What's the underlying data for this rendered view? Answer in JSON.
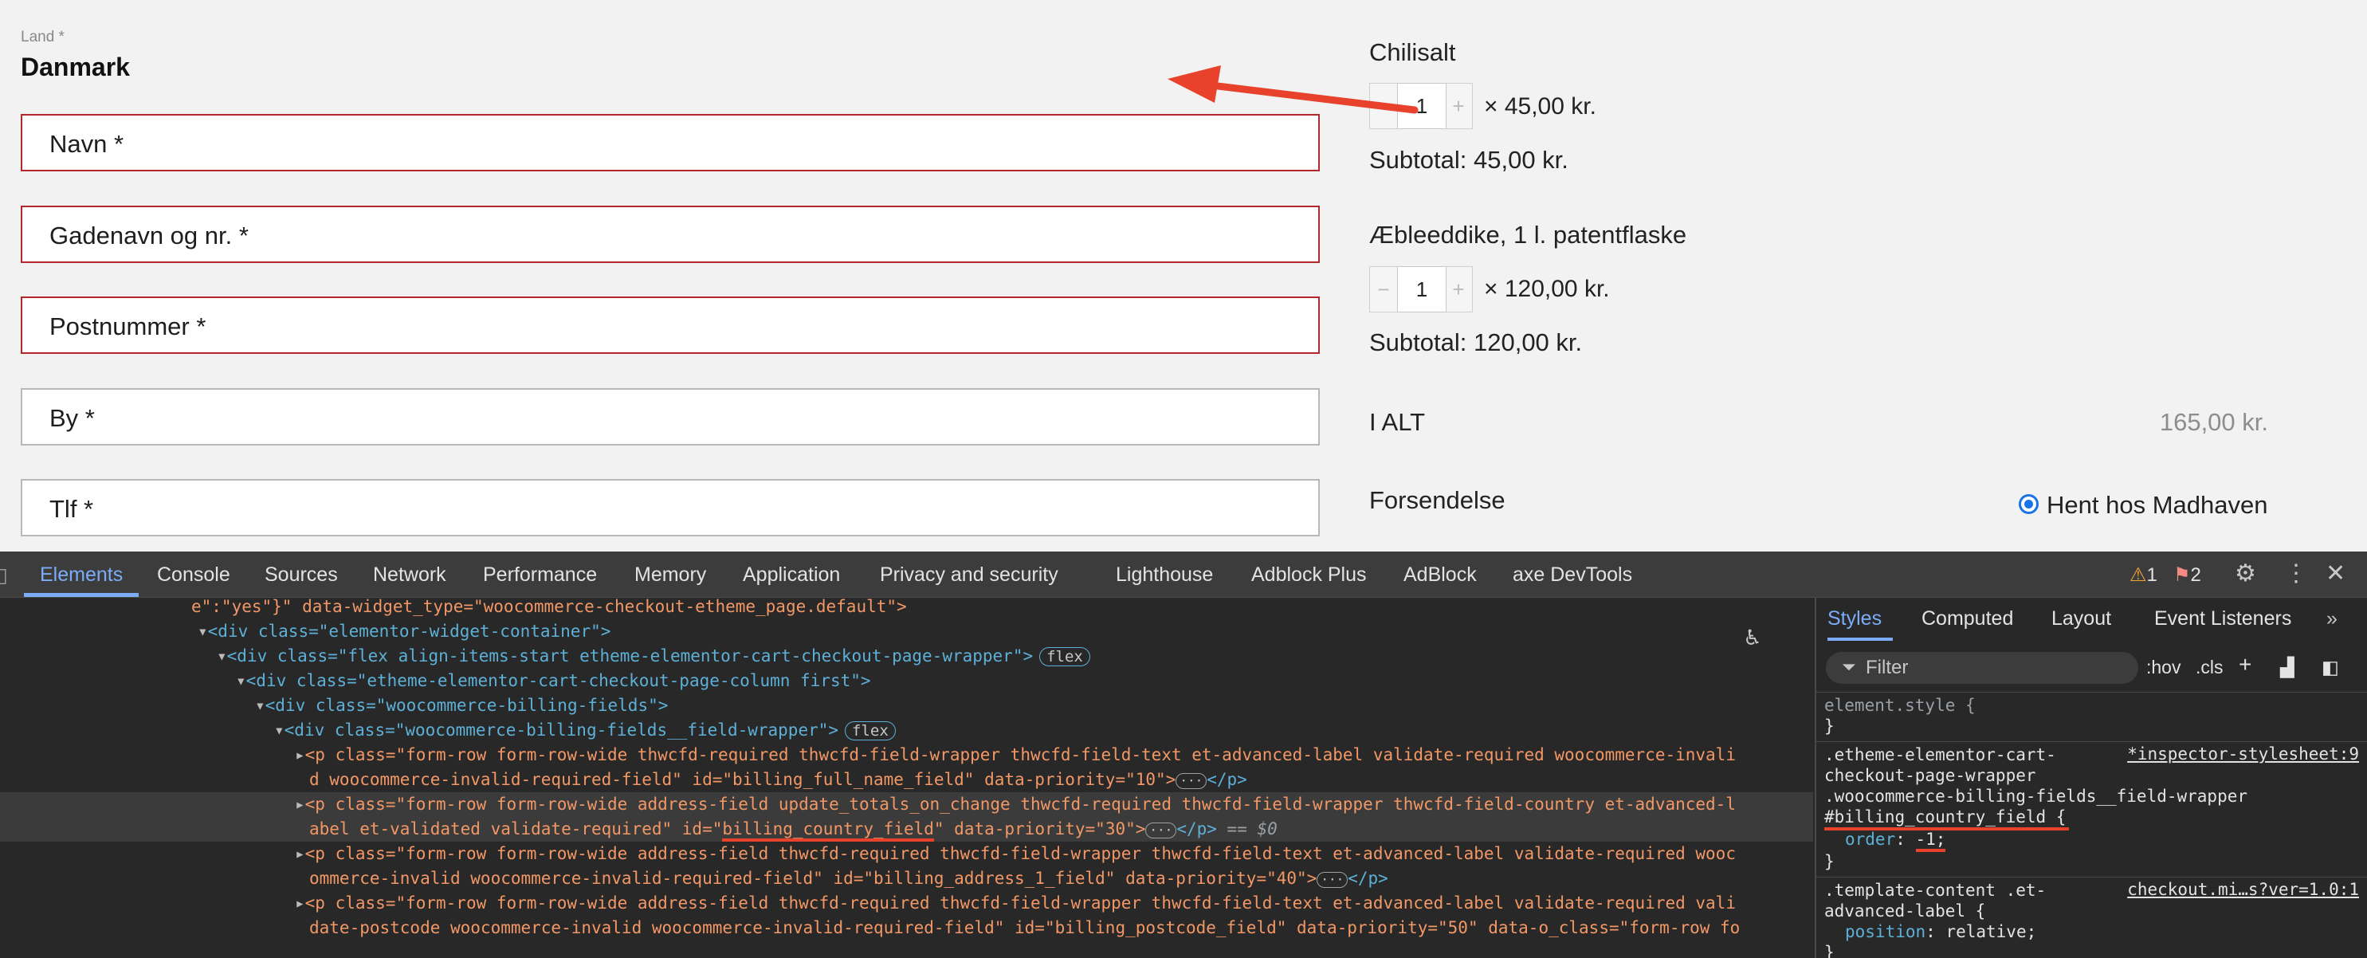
{
  "checkout": {
    "country_label": "Land *",
    "country_value": "Danmark",
    "fields": [
      {
        "label": "Navn *",
        "invalid": true
      },
      {
        "label": "Gadenavn og nr. *",
        "invalid": true
      },
      {
        "label": "Postnummer *",
        "invalid": true
      },
      {
        "label": "By *",
        "invalid": false
      },
      {
        "label": "Tlf *",
        "invalid": false
      }
    ]
  },
  "order": {
    "items": [
      {
        "name": "Chilisalt",
        "qty": "1",
        "price": "× 45,00 kr.",
        "subtotal": "Subtotal: 45,00 kr."
      },
      {
        "name": "Æbleeddike, 1 l. patentflaske",
        "qty": "1",
        "price": "× 120,00 kr.",
        "subtotal": "Subtotal: 120,00 kr."
      }
    ],
    "total_label": "I ALT",
    "total_value": "165,00 kr.",
    "shipping_label": "Forsendelse",
    "shipping_option": "Hent hos Madhaven",
    "minus": "−",
    "plus": "+"
  },
  "annotation": {
    "arrow_color": "#e8412c"
  },
  "devtools": {
    "tabs": [
      "Elements",
      "Console",
      "Sources",
      "Network",
      "Performance",
      "Memory",
      "Application",
      "Privacy and security",
      "Lighthouse",
      "Adblock Plus",
      "AdBlock",
      "axe DevTools"
    ],
    "warnings": "1",
    "errors": "2",
    "elements": {
      "line0": "e\":\"yes\"}\" data-widget_type=\"woocommerce-checkout-etheme_page.default\">",
      "line1_tag": "<div class=\"elementor-widget-container\">",
      "line2_tag": "<div class=\"flex align-items-start etheme-elementor-cart-checkout-page-wrapper\">",
      "flex_badge": "flex",
      "line3_tag": "<div class=\"etheme-elementor-cart-checkout-page-column first\">",
      "line4_tag": "<div class=\"woocommerce-billing-fields\">",
      "line5_tag": "<div class=\"woocommerce-billing-fields__field-wrapper\">",
      "line6a": "<p class=\"form-row form-row-wide thwcfd-required thwcfd-field-wrapper thwcfd-field-text et-advanced-label validate-required woocommerce-invali",
      "line6b": "d woocommerce-invalid-required-field\" id=\"billing_full_name_field\" data-priority=\"10\">",
      "line7a": "<p class=\"form-row form-row-wide address-field update_totals_on_change thwcfd-required thwcfd-field-wrapper thwcfd-field-country et-advanced-l",
      "line7b_pre": "abel et-validated validate-required\" id=\"",
      "line7b_id": "billing_country_field",
      "line7b_post": "\" data-priority=\"30\">",
      "dollar0": "== $0",
      "line8a": "<p class=\"form-row form-row-wide address-field thwcfd-required thwcfd-field-wrapper thwcfd-field-text et-advanced-label validate-required wooc",
      "line8b": "ommerce-invalid woocommerce-invalid-required-field\" id=\"billing_address_1_field\" data-priority=\"40\">",
      "line9a": "<p class=\"form-row form-row-wide address-field thwcfd-required thwcfd-field-wrapper thwcfd-field-text et-advanced-label validate-required vali",
      "line9b": "date-postcode woocommerce-invalid woocommerce-invalid-required-field\" id=\"billing_postcode_field\" data-priority=\"50\" data-o_class=\"form-row fo",
      "close_p": "</p>",
      "ellipsis": "···"
    },
    "styles": {
      "tabs": [
        "Styles",
        "Computed",
        "Layout",
        "Event Listeners"
      ],
      "filter_placeholder": "Filter",
      "hov": ":hov",
      "cls": ".cls",
      "element_style": "element.style {",
      "close_brace": "}",
      "rule1_sel1": ".etheme-elementor-cart-",
      "rule1_sel2": "checkout-page-wrapper",
      "rule1_sel3": ".woocommerce-billing-fields__field-wrapper",
      "rule1_sel4": "#billing_country_field {",
      "rule1_prop": "order",
      "rule1_val": "-1;",
      "rule1_src": "*inspector-stylesheet:9",
      "rule2_sel1": ".template-content .et-",
      "rule2_sel2": "advanced-label {",
      "rule2_prop": "position",
      "rule2_val": "relative;",
      "rule2_src": "checkout.mi…s?ver=1.0:1"
    }
  }
}
